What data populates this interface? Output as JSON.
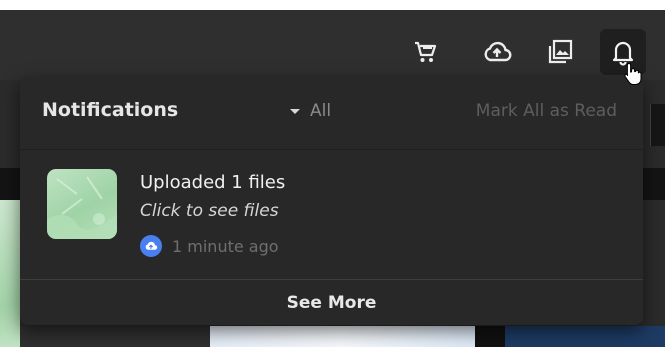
{
  "header": {
    "icons": [
      {
        "name": "cart-icon"
      },
      {
        "name": "cloud-upload-icon"
      },
      {
        "name": "gallery-icon"
      },
      {
        "name": "bell-icon"
      }
    ]
  },
  "notifications_panel": {
    "title": "Notifications",
    "filter": {
      "selected": "All"
    },
    "mark_all_label": "Mark All as Read",
    "items": [
      {
        "title": "Uploaded 1 files",
        "subtitle": "Click to see files",
        "time": "1 minute ago",
        "icon": "cloud-upload-icon"
      }
    ],
    "see_more_label": "See More"
  },
  "colors": {
    "panel_bg": "#282828",
    "header_bg": "#2f2f2f",
    "badge_blue": "#4a7ff0",
    "muted_text": "#6f6f6f"
  }
}
